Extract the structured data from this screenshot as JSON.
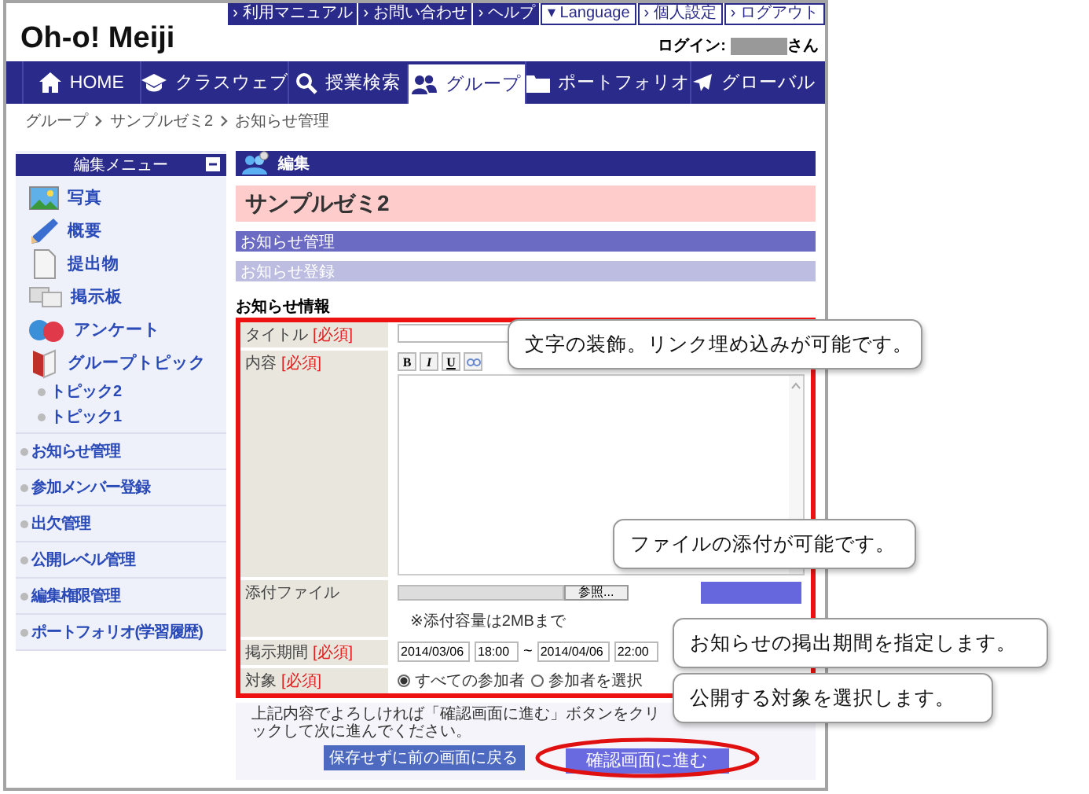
{
  "header": {
    "logo": "Oh-o! Meiji",
    "top_links": [
      {
        "mark": "›",
        "label": "利用マニュアル",
        "kind": "dark"
      },
      {
        "mark": "›",
        "label": "お問い合わせ",
        "kind": "dark"
      },
      {
        "mark": "›",
        "label": "ヘルプ",
        "kind": "dark"
      },
      {
        "mark": "▾",
        "label": "Language",
        "kind": "light"
      },
      {
        "mark": "›",
        "label": "個人設定",
        "kind": "light"
      },
      {
        "mark": "›",
        "label": "ログアウト",
        "kind": "light"
      }
    ],
    "login": {
      "label": "ログイン:",
      "suffix": "さん"
    }
  },
  "nav": [
    {
      "label": "HOME",
      "selected": false
    },
    {
      "label": "クラスウェブ",
      "selected": false
    },
    {
      "label": "授業検索",
      "selected": false
    },
    {
      "label": "グループ",
      "selected": true
    },
    {
      "label": "ポートフォリオ",
      "selected": false
    },
    {
      "label": "グローバル",
      "selected": false
    }
  ],
  "breadcrumb": [
    "グループ",
    "サンプルゼミ2",
    "お知らせ管理"
  ],
  "sidebar": {
    "title": "編集メニュー",
    "items": [
      {
        "label": "写真"
      },
      {
        "label": "概要"
      },
      {
        "label": "提出物"
      },
      {
        "label": "掲示板"
      },
      {
        "label": "アンケート"
      },
      {
        "label": "グループトピック",
        "children": [
          {
            "label": "トピック2"
          },
          {
            "label": "トピック1"
          }
        ]
      }
    ],
    "links": [
      "お知らせ管理",
      "参加メンバー登録",
      "出欠管理",
      "公開レベル管理",
      "編集権限管理",
      "ポートフォリオ(学習履歴)"
    ]
  },
  "main": {
    "header": "編集",
    "group_name": "サンプルゼミ2",
    "section_bars": [
      {
        "label": "お知らせ管理",
        "kind": "primary"
      },
      {
        "label": "お知らせ登録",
        "kind": "secondary"
      }
    ],
    "form": {
      "title": "お知らせ情報",
      "rows": [
        {
          "kind": "text",
          "label": "タイトル",
          "required": "[必須]"
        },
        {
          "kind": "editor",
          "label": "内容",
          "required": "[必須]",
          "tools": [
            "B",
            "I",
            "U"
          ]
        },
        {
          "kind": "file",
          "label": "添付ファイル",
          "browse": "参照...",
          "note": "※添付容量は2MBまで"
        },
        {
          "kind": "period",
          "label": "掲示期間",
          "required": "[必須]",
          "start_date": "2014/03/06",
          "start_time": "18:00",
          "separator": "~",
          "end_date": "2014/04/06",
          "end_time": "22:00"
        },
        {
          "kind": "radio",
          "label": "対象",
          "required": "[必須]",
          "options": [
            {
              "label": "すべての参加者",
              "selected": true
            },
            {
              "label": "参加者を選択",
              "selected": false
            }
          ]
        }
      ]
    },
    "footer": {
      "note": "上記内容でよろしければ「確認画面に進む」ボタンをクリックして次に進んでください。",
      "back_button": "保存せずに前の画面に戻る",
      "confirm_button": "確認画面に進む"
    }
  },
  "callouts": [
    "文字の装飾。リンク埋め込みが可能です。",
    "ファイルの添付が可能です。",
    "お知らせの掲出期間を指定します。",
    "公開する対象を選択します。"
  ]
}
